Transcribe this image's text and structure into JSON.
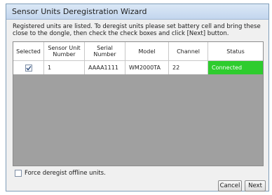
{
  "window": {
    "title": "Sensor Units Deregistration Wizard"
  },
  "instructions": "Registered units are listed. To deregist units please set battery cell and bring these close to the dongle, then check the check boxes and click [Next] button.",
  "table": {
    "columns": [
      "Selected",
      "Sensor Unit Number",
      "Serial Number",
      "Model",
      "Channel",
      "Status"
    ],
    "rows": [
      {
        "selected": true,
        "sensor_unit_number": "1",
        "serial_number": "AAAA1111",
        "model": "WM2000TA",
        "channel": "22",
        "status": "Connected"
      }
    ]
  },
  "options": {
    "force_deregist_label": "Force deregist offline units.",
    "force_deregist_checked": false
  },
  "buttons": {
    "cancel": "Cancel",
    "next": "Next"
  },
  "colors": {
    "status_connected": "#2ecc2e",
    "empty_grid_area": "#a0a0a0"
  }
}
